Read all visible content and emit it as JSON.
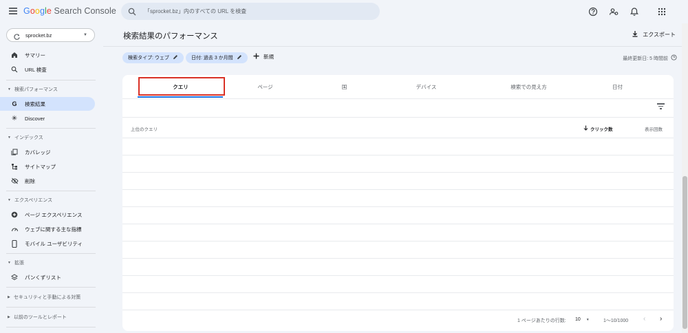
{
  "app": {
    "title_parts": [
      "G",
      "o",
      "o",
      "g",
      "l",
      "e"
    ],
    "title_suffix": "Search Console"
  },
  "search": {
    "placeholder": "「sprocket.bz」内のすべての URL を検査"
  },
  "top_icons": [
    "help-icon",
    "manage-users-icon",
    "notifications-icon",
    "apps-grid-icon"
  ],
  "property": {
    "label": "sprocket.bz"
  },
  "sidebar": {
    "summary": "サマリー",
    "url_inspection": "URL 検査",
    "sec_performance": "検索パフォーマンス",
    "search_results": "検索結果",
    "discover": "Discover",
    "sec_index": "インデックス",
    "coverage": "カバレッジ",
    "sitemaps": "サイトマップ",
    "removals": "削除",
    "sec_experience": "エクスペリエンス",
    "page_experience": "ページ エクスペリエンス",
    "web_vitals": "ウェブに関する主な指標",
    "mobile_usability": "モバイル ユーザビリティ",
    "sec_enhancements": "拡張",
    "breadcrumbs": "パンくずリスト",
    "sec_security": "セキュリティと手動による対策",
    "sec_legacy": "以前のツールとレポート"
  },
  "main": {
    "page_title": "検索結果のパフォーマンス",
    "export_label": "エクスポート",
    "chip_search_type": "検索タイプ: ウェブ",
    "chip_date": "日付: 過去 3 か月間",
    "new_label": "新規",
    "last_updated": "最終更新日: 5 時間前"
  },
  "tabs": [
    "クエリ",
    "ページ",
    "国",
    "デバイス",
    "検索での見え方",
    "日付"
  ],
  "table": {
    "col_query": "上位のクエリ",
    "col_clicks": "クリック数",
    "col_impressions": "表示回数",
    "rows_per_page_label": "1 ページあたりの行数:",
    "rows_per_page_value": "10",
    "range": "1〜10/1000"
  },
  "colors": {
    "accent": "#1a73e8",
    "active_nav": "#d3e3fd",
    "highlight_box": "#d93025"
  }
}
